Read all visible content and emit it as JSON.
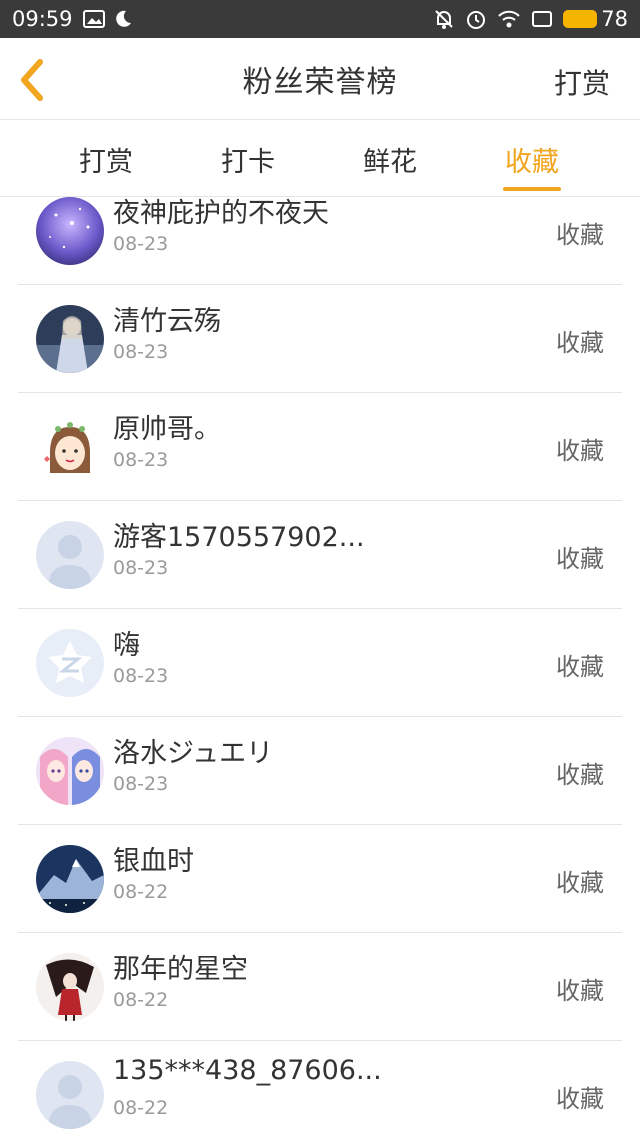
{
  "status_bar": {
    "time": "09:59",
    "battery": "78",
    "icons": [
      "image-icon",
      "moon-icon",
      "mute-icon",
      "alarm-icon",
      "wifi-icon",
      "screen-icon",
      "battery-icon"
    ]
  },
  "header": {
    "title": "粉丝荣誉榜",
    "action_label": "打赏",
    "back_icon": "chevron-left-icon"
  },
  "tabs": [
    {
      "label": "打赏",
      "active": false
    },
    {
      "label": "打卡",
      "active": false
    },
    {
      "label": "鲜花",
      "active": false
    },
    {
      "label": "收藏",
      "active": true
    }
  ],
  "accent_color": "#f2a51f",
  "list": [
    {
      "name": "夜神庇护的不夜天",
      "date": "08-23",
      "type": "收藏",
      "avatar": "starry-sky-avatar"
    },
    {
      "name": "清竹云殇",
      "date": "08-23",
      "type": "收藏",
      "avatar": "anime-girl-night-avatar"
    },
    {
      "name": "原帅哥。",
      "date": "08-23",
      "type": "收藏",
      "avatar": "cartoon-girl-avatar"
    },
    {
      "name": "游客1570557902...",
      "date": "08-23",
      "type": "收藏",
      "avatar": "default-user-avatar"
    },
    {
      "name": "嗨",
      "date": "08-23",
      "type": "收藏",
      "avatar": "qzone-default-avatar"
    },
    {
      "name": "洛水ジュエリ",
      "date": "08-23",
      "type": "收藏",
      "avatar": "anime-twins-avatar"
    },
    {
      "name": "银血时",
      "date": "08-22",
      "type": "收藏",
      "avatar": "mountain-night-avatar"
    },
    {
      "name": "那年的星空",
      "date": "08-22",
      "type": "收藏",
      "avatar": "dark-anime-avatar"
    },
    {
      "name": "135***438_87606...",
      "date": "08-22",
      "type": "收藏",
      "avatar": "default-user-avatar"
    }
  ]
}
